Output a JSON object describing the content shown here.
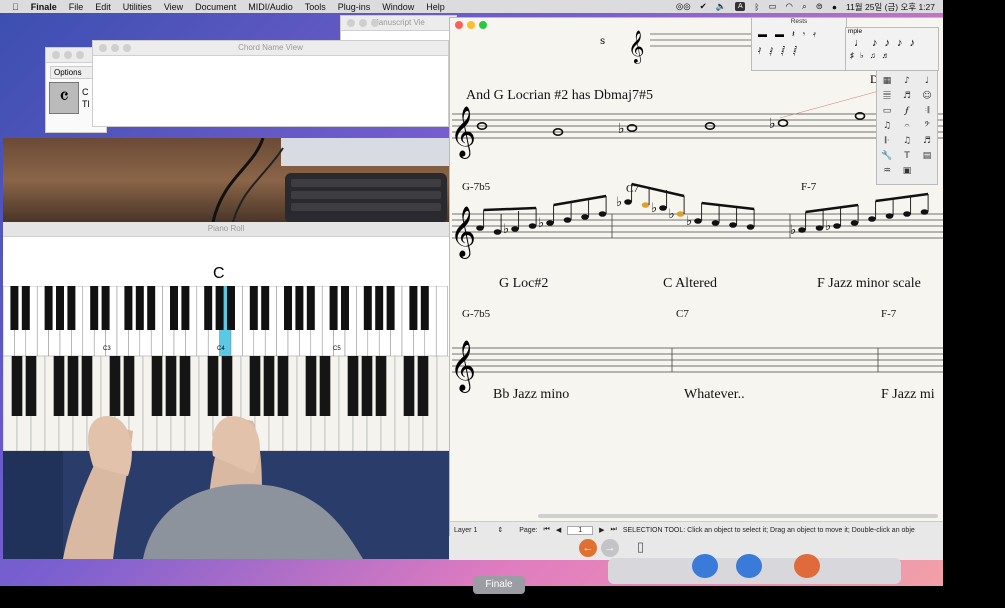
{
  "menubar": {
    "apple": "",
    "items": [
      "Finale",
      "File",
      "Edit",
      "Utilities",
      "View",
      "Document",
      "MIDI/Audio",
      "Tools",
      "Plug-ins",
      "Window",
      "Help"
    ],
    "clock": "11월 25일 (금) 오후 1:27",
    "input_badge": "A"
  },
  "windows": {
    "chord_name_view": {
      "title": "Chord Name View"
    },
    "options": {
      "tab": "Options",
      "text1": "C",
      "text2": "Tl"
    },
    "manuscript": {
      "title": "Manuscript Vie"
    },
    "piano_roll": {
      "title": "Piano Roll",
      "current_note": "C",
      "key_labels": [
        "C3",
        "C4",
        "C5"
      ]
    }
  },
  "finale": {
    "heading": "And G Locrian #2 has Dbmaj7#5",
    "top_clef_glyph": "𝄞",
    "chords_row1": [
      "G-7b5",
      "C7",
      "F-7"
    ],
    "scales_row1": [
      "G Loc#2",
      "C Altered",
      "F Jazz minor scale"
    ],
    "chords_row2": [
      "G-7b5",
      "C7",
      "F-7"
    ],
    "scales_row2": [
      "Bb Jazz mino",
      "Whatever..",
      "F Jazz mi"
    ],
    "d_label": "D",
    "status": {
      "layer": "Layer 1",
      "page_label": "Page:",
      "page_value": "1",
      "message": "SELECTION TOOL: Click an object to select it; Drag an object to move it; Double-click an obje"
    }
  },
  "palettes": {
    "rests_title": "Rests",
    "simple_label": "mple"
  },
  "dock": {
    "tooltip": "Finale"
  },
  "colors": {
    "accent_highlight": "#5bc8e6",
    "note_highlight": "#e0a030"
  }
}
